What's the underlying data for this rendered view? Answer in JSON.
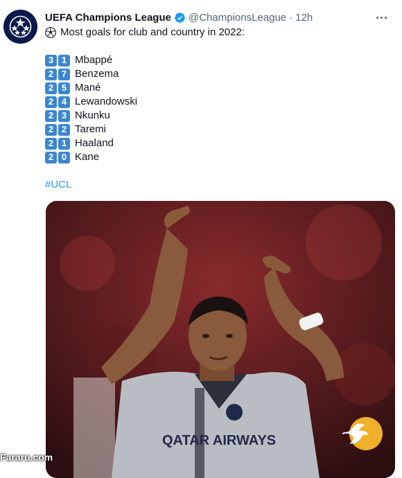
{
  "account": {
    "name": "UEFA Champions League",
    "handle": "@ChampionsLeague",
    "separator": "·",
    "time": "12h",
    "verified_color": "#1d9bf0"
  },
  "tweet": {
    "intro": "Most goals for club and country in 2022:",
    "leaders": [
      {
        "d1": "3",
        "d2": "1",
        "name": "Mbappé"
      },
      {
        "d1": "2",
        "d2": "7",
        "name": "Benzema"
      },
      {
        "d1": "2",
        "d2": "5",
        "name": "Mané"
      },
      {
        "d1": "2",
        "d2": "4",
        "name": "Lewandowski"
      },
      {
        "d1": "2",
        "d2": "3",
        "name": "Nkunku"
      },
      {
        "d1": "2",
        "d2": "2",
        "name": "Taremi"
      },
      {
        "d1": "2",
        "d2": "1",
        "name": "Haaland"
      },
      {
        "d1": "2",
        "d2": "0",
        "name": "Kane"
      }
    ],
    "hashtag": "#UCL"
  },
  "media": {
    "jersey_text": "QATAR AIRWAYS"
  },
  "watermark": {
    "text": "Fararu.com"
  },
  "colors": {
    "keycap": "#3b86d1",
    "hashtag": "#1d9bf0",
    "secondary_text": "#536471"
  }
}
